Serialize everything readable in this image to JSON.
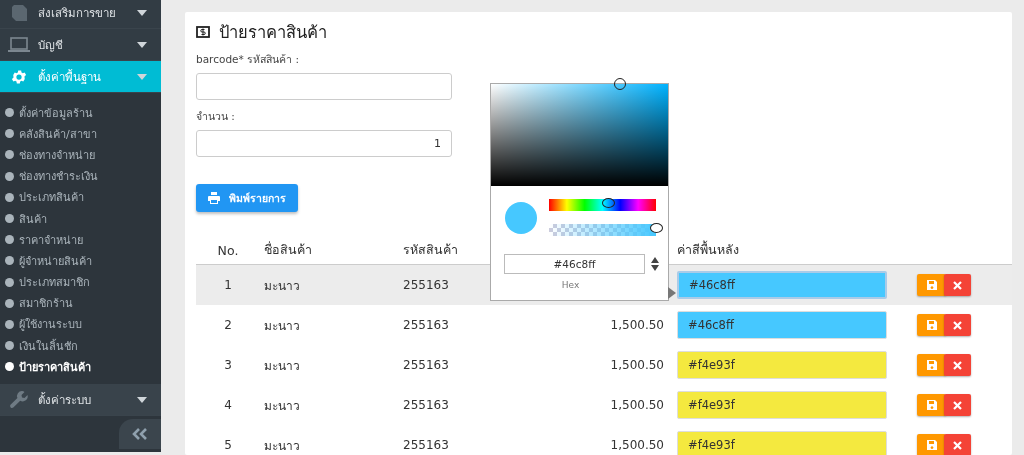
{
  "sidebar": {
    "menu": [
      {
        "label": "ส่งเสริมการขาย",
        "expanded": false
      },
      {
        "label": "บัญชี",
        "expanded": false
      },
      {
        "label": "ตั้งค่าพื้นฐาน",
        "expanded": true,
        "children": [
          {
            "label": "ตั้งค่าข้อมูลร้าน",
            "selected": false
          },
          {
            "label": "คลังสินค้า/สาขา",
            "selected": false
          },
          {
            "label": "ช่องทางจำหน่าย",
            "selected": false
          },
          {
            "label": "ช่องทางชำระเงิน",
            "selected": false
          },
          {
            "label": "ประเภทสินค้า",
            "selected": false
          },
          {
            "label": "สินค้า",
            "selected": false
          },
          {
            "label": "ราคาจำหน่าย",
            "selected": false
          },
          {
            "label": "ผู้จำหน่ายสินค้า",
            "selected": false
          },
          {
            "label": "ประเภทสมาชิก",
            "selected": false
          },
          {
            "label": "สมาชิกร้าน",
            "selected": false
          },
          {
            "label": "ผู้ใช้งานระบบ",
            "selected": false
          },
          {
            "label": "เงินในลิ้นชัก",
            "selected": false
          },
          {
            "label": "ป้ายราคาสินค้า",
            "selected": true
          }
        ]
      },
      {
        "label": "ตั้งค่าระบบ",
        "expanded": false
      }
    ]
  },
  "page": {
    "title": "ป้ายราคาสินค้า",
    "fields": [
      {
        "label": "barcode* รหัสสินค้า :"
      },
      {
        "label": "จำนวน :",
        "value": "1"
      }
    ],
    "print_button": "พิมพ์รายการ",
    "table": {
      "columns": [
        "No.",
        "ชื่อสินค้า",
        "รหัสสินค้า",
        "ค่าสีพื้นหลัง"
      ],
      "rows": [
        {
          "no": "1",
          "name": "มะนาว",
          "code": "255163",
          "color_value": "#46c8ff",
          "color": "#46c8ff",
          "selected": true
        },
        {
          "no": "2",
          "name": "มะนาว",
          "code": "255163",
          "price": "1,500.50",
          "color_value": "#46c8ff",
          "color": "#46c8ff",
          "selected": false
        },
        {
          "no": "3",
          "name": "มะนาว",
          "code": "255163",
          "price": "1,500.50",
          "color_value": "#f4e93f",
          "color": "#f4e93f",
          "selected": false
        },
        {
          "no": "4",
          "name": "มะนาว",
          "code": "255163",
          "price": "1,500.50",
          "color_value": "#f4e93f",
          "color": "#f4e93f",
          "selected": false
        },
        {
          "no": "5",
          "name": "มะนาว",
          "code": "255163",
          "price": "1,500.50",
          "color_value": "#f4e93f",
          "color": "#f4e93f",
          "selected": false
        }
      ]
    },
    "color_picker": {
      "color": "#46c8ff",
      "saturation": {
        "level": 0.73
      },
      "hue": {
        "level": 0.55
      },
      "alpha": {
        "level": 1
      },
      "hex_value": "#46c8ff",
      "format_label": "Hex"
    }
  }
}
